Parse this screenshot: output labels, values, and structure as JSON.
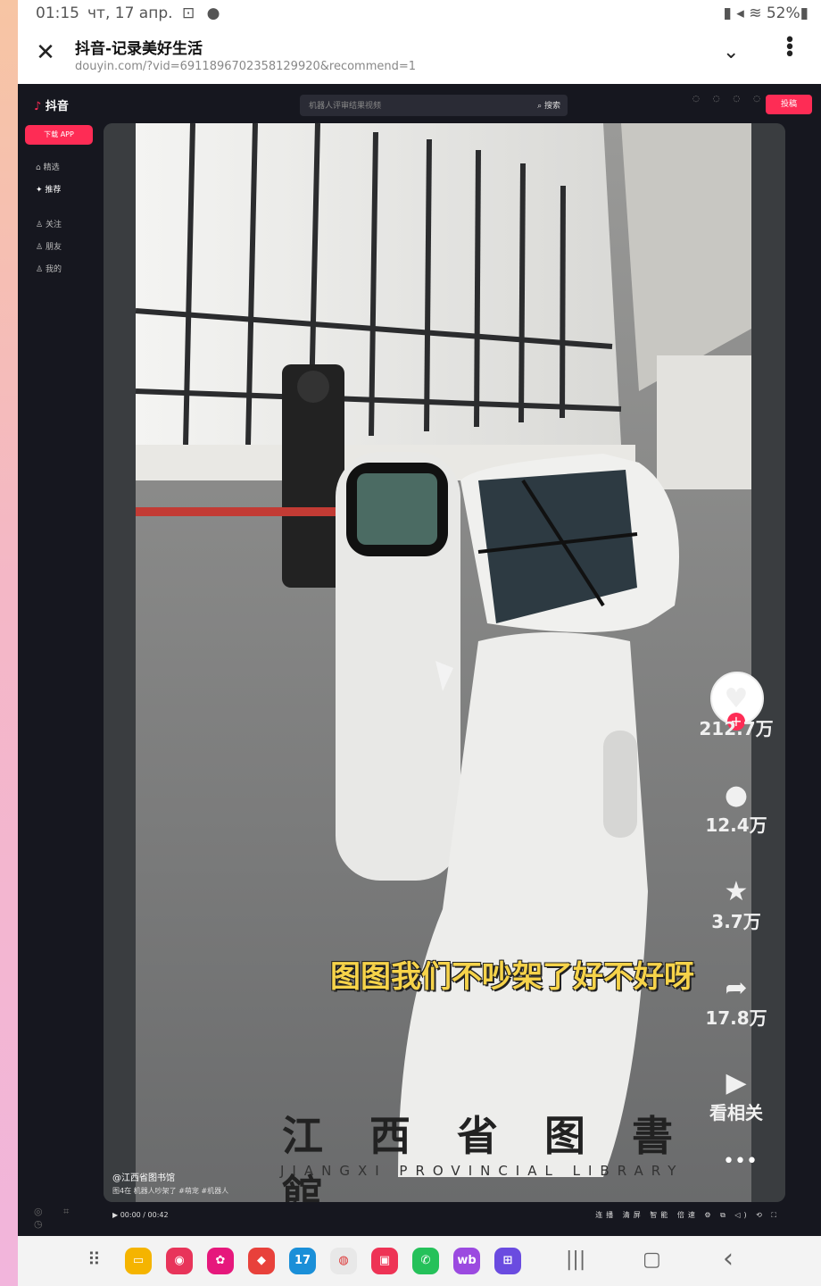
{
  "status_bar": {
    "time": "01:15",
    "date": "чт, 17 апр.",
    "left_icons": "⊡ ●",
    "right": "▮ ◂ ≋ 52%▮"
  },
  "browser": {
    "title": "抖音-记录美好生活",
    "url": "douyin.com/?vid=6911896702358129920&recommend=1",
    "close_icon": "close-icon",
    "chevron_icon": "chevron-down-icon",
    "menu_icon": "more-vertical-icon"
  },
  "douyin": {
    "logo": "抖音",
    "search_placeholder": "机器人评审结果视频",
    "search_button": "搜索",
    "header_icons": "◌ ◌ ◌ ◌",
    "upload": "投稿",
    "sidebar": {
      "download": "下载 APP",
      "items": [
        "精选",
        "推荐",
        "关注",
        "朋友",
        "我的"
      ],
      "bottom_icons": "◎ ⌗ ◷"
    },
    "video": {
      "caption": "图图我们不吵架了好不好呀",
      "watermark_cn": "江 西 省 图 書 館",
      "watermark_en": "JIANGXI PROVINCIAL LIBRARY",
      "author": "@江西省图书馆",
      "description": "图4在 机器人吵架了 #萌宠 #机器人"
    },
    "actions": {
      "likes": "212.7万",
      "comments": "12.4万",
      "favorites": "3.7万",
      "shares": "17.8万",
      "related": "看相关",
      "more": "•••"
    },
    "player": {
      "time": "00:00 / 00:42",
      "controls": "连播 清屏 智能 倍速 ⚙ ⧉ ◁) ⟲ ⛶"
    }
  },
  "nav": {
    "apps_icon": "⠿",
    "apps": [
      {
        "label": "▭",
        "color": "#f5b400"
      },
      {
        "label": "◉",
        "color": "#e8345a"
      },
      {
        "label": "✿",
        "color": "#e6187c"
      },
      {
        "label": "◆",
        "color": "#e8413b"
      },
      {
        "label": "17",
        "color": "#1a8fd8"
      },
      {
        "label": "◍",
        "color": "#e8e8e8"
      },
      {
        "label": "▣",
        "color": "#ee3355"
      },
      {
        "label": "✆",
        "color": "#25c15a"
      },
      {
        "label": "wb",
        "color": "#9b4ae0"
      },
      {
        "label": "⊞",
        "color": "#6a4be0"
      }
    ],
    "recents": "|||",
    "home": "▢",
    "back": "‹"
  }
}
